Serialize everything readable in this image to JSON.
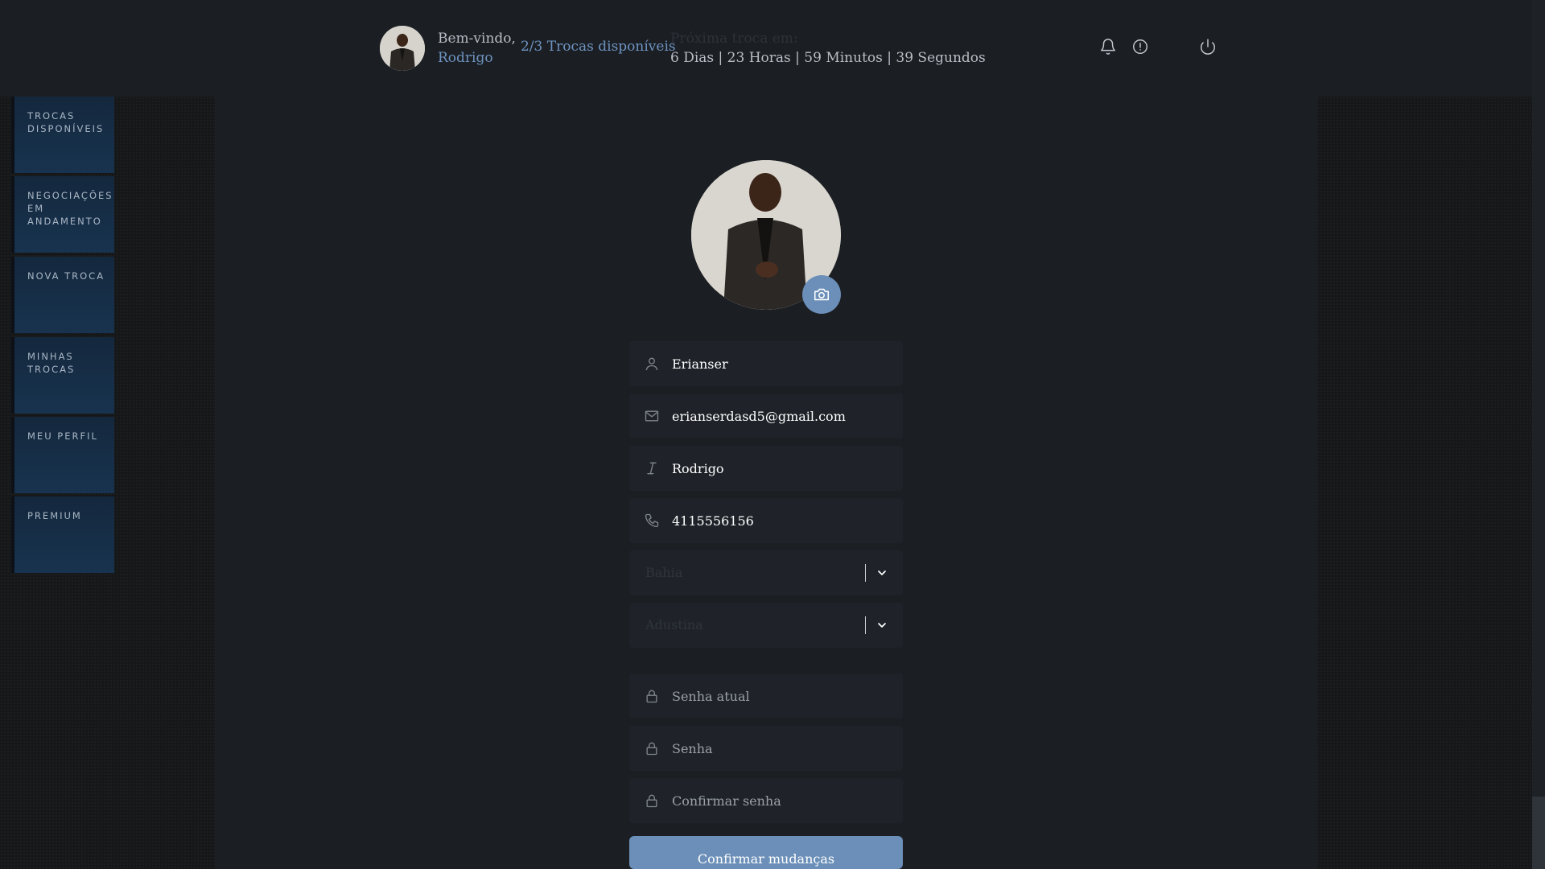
{
  "header": {
    "greeting": "Bem-vindo,",
    "username": "Rodrigo",
    "trades_available": "2/3 Trocas disponíveis",
    "next_trade_label": "Próxima troca em:",
    "countdown": "6 Dias | 23 Horas | 59 Minutos | 39 Segundos",
    "icons": [
      "bell-icon",
      "alert-circle-icon",
      "power-icon"
    ]
  },
  "sidebar": {
    "items": [
      {
        "label": "TROCAS DISPONÍVEIS"
      },
      {
        "label": "NEGOCIAÇÕES EM ANDAMENTO"
      },
      {
        "label": "NOVA TROCA"
      },
      {
        "label": "MINHAS TROCAS"
      },
      {
        "label": "MEU PERFIL"
      },
      {
        "label": "PREMIUM"
      }
    ]
  },
  "profile": {
    "username": "Erianser",
    "email": "erianserdasd5@gmail.com",
    "name": "Rodrigo",
    "phone": "4115556156",
    "state": "Bahia",
    "city": "Adustina",
    "current_password_placeholder": "Senha atual",
    "password_placeholder": "Senha",
    "confirm_password_placeholder": "Confirmar senha",
    "confirm_button": "Confirmar mudanças"
  },
  "colors": {
    "accent": "#6b8fb8",
    "link": "#6e93c0",
    "sidebar_bg": "#18334f"
  }
}
